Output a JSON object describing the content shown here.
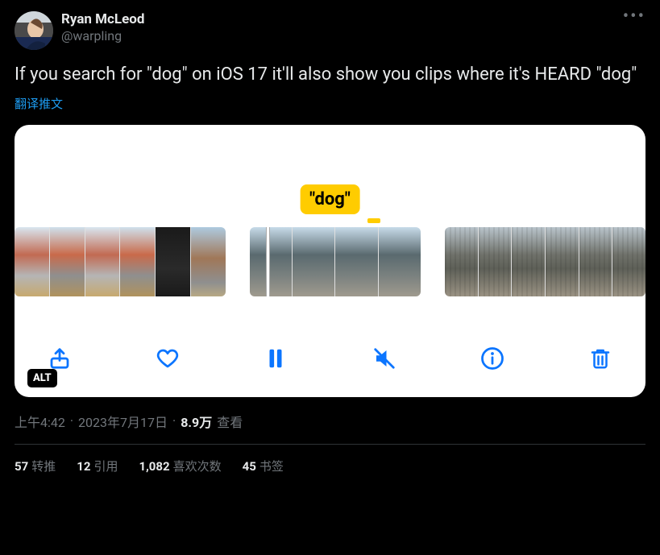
{
  "author": {
    "name": "Ryan McLeod",
    "handle": "@warpling"
  },
  "content": "If you search for \"dog\" on iOS 17 it'll also show you clips where it's HEARD \"dog\"",
  "translate_label": "翻译推文",
  "media": {
    "tooltip_text": "\"dog\"",
    "alt_badge": "ALT"
  },
  "meta": {
    "time": "上午4:42",
    "date": "2023年7月17日",
    "views_value": "8.9万",
    "views_label": "查看"
  },
  "stats": {
    "retweets": {
      "count": "57",
      "label": "转推"
    },
    "quotes": {
      "count": "12",
      "label": "引用"
    },
    "likes": {
      "count": "1,082",
      "label": "喜欢次数"
    },
    "bookmarks": {
      "count": "45",
      "label": "书签"
    }
  }
}
